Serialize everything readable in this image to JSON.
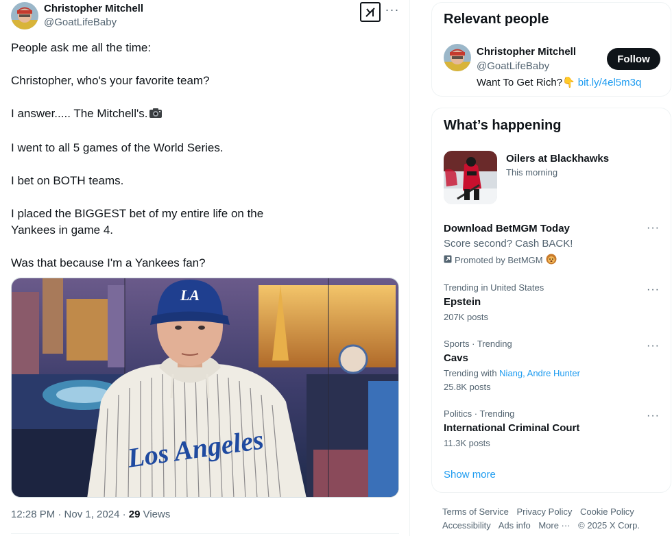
{
  "tweet": {
    "author_name": "Christopher Mitchell",
    "author_handle": "@GoatLifeBaby",
    "grok_icon": "grok-icon",
    "more_icon": "more-dots-icon",
    "paragraphs": [
      "People ask me all the time:",
      "Christopher, who's your favorite team?",
      "I answer..... The Mitchell's.",
      "I went to all 5 games of the World Series.",
      "I bet on BOTH teams.",
      "I placed the BIGGEST bet of my entire life on the\nYankees in game 4.",
      "Was that because I'm a Yankees fan?"
    ],
    "media_alt": "Man in Los Angeles Dodgers cap and pinstripe hoodie in front of Las Vegas strip backdrop",
    "hoodie_text": "Los Angeles",
    "cap_text": "LA",
    "time": "12:28 PM · Nov 1, 2024 · ",
    "views_count": "29",
    "views_label": " Views"
  },
  "relevant_people": {
    "title": "Relevant people",
    "name": "Christopher Mitchell",
    "handle": "@GoatLifeBaby",
    "bio": "Want To Get Rich?",
    "bio_link": "bit.ly/4el5m3q",
    "follow_label": "Follow"
  },
  "happening": {
    "title": "What’s happening",
    "sport_event": {
      "title": "Oilers at Blackhawks",
      "subtitle": "This morning"
    },
    "promoted": {
      "title": "Download BetMGM Today",
      "subtitle": "Score second? Cash BACK!",
      "by": "Promoted by BetMGM"
    },
    "trends": [
      {
        "context": "Trending in United States",
        "topic": "Epstein",
        "posts": "207K posts"
      },
      {
        "context": "Sports · Trending",
        "topic": "Cavs",
        "trending_with_label": "Trending with ",
        "trending_with": "Niang, Andre Hunter",
        "posts": "25.8K posts"
      },
      {
        "context": "Politics · Trending",
        "topic": "International Criminal Court",
        "posts": "11.3K posts"
      }
    ],
    "show_more": "Show more"
  },
  "footer": {
    "links": [
      "Terms of Service",
      "Privacy Policy",
      "Cookie Policy",
      "Accessibility",
      "Ads info",
      "More ···",
      "© 2025 X Corp."
    ]
  }
}
